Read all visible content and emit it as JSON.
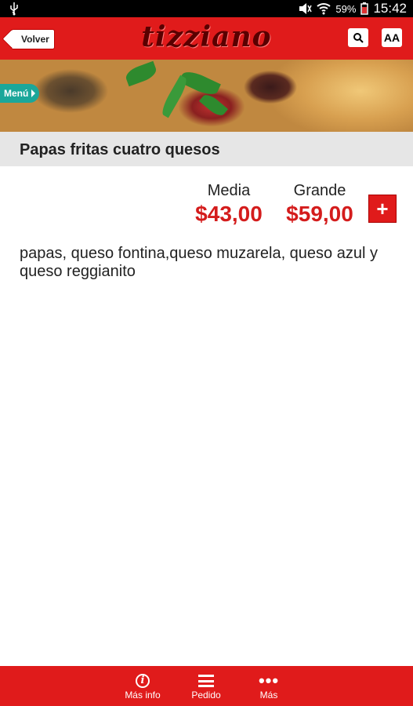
{
  "status_bar": {
    "time": "15:42",
    "battery": "59%",
    "icons": [
      "usb-icon",
      "mute-icon",
      "wifi-icon",
      "signal-icon",
      "battery-icon"
    ]
  },
  "header": {
    "back_label": "Volver",
    "logo": "tizziano",
    "search_icon": "search-icon",
    "font_size_label": "AA",
    "accent_color": "#e01b1b"
  },
  "banner": {
    "menu_tag": "Menú"
  },
  "product": {
    "title": "Papas fritas cuatro quesos",
    "prices": [
      {
        "label": "Media",
        "value": "$43,00"
      },
      {
        "label": "Grande",
        "value": "$59,00"
      }
    ],
    "add_label": "+",
    "description": "papas, queso fontina,queso muzarela, queso azul y queso reggianito",
    "price_color": "#d41c1c"
  },
  "bottom_nav": {
    "items": [
      {
        "label": "Más info",
        "icon": "info-icon"
      },
      {
        "label": "Pedido",
        "icon": "list-icon"
      },
      {
        "label": "Más",
        "icon": "more-icon"
      }
    ]
  }
}
